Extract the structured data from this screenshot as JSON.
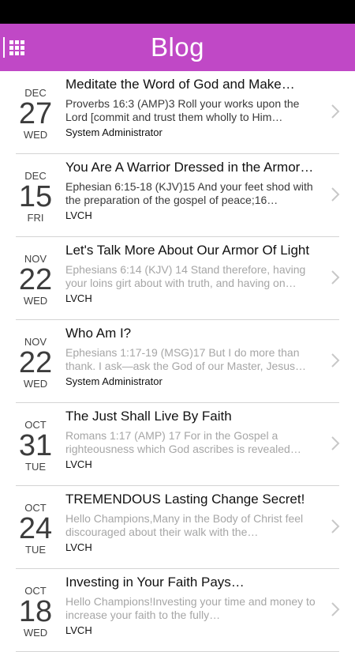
{
  "app": {
    "title": "Blog"
  },
  "icons": {
    "menu": "grid-menu-icon",
    "chevron": "chevron-right-icon"
  },
  "colors": {
    "appbar": "#c048c6",
    "statusbar": "#000000"
  },
  "posts": [
    {
      "month": "DEC",
      "day": "27",
      "dow": "WED",
      "title": "Meditate the Word of God and Make…",
      "excerpt": "Proverbs 16:3 (AMP)3 Roll your works upon the Lord [commit and trust them wholly to Him…",
      "author": "System Administrator",
      "faded": false
    },
    {
      "month": "DEC",
      "day": "15",
      "dow": "FRI",
      "title": "You Are A Warrior Dressed in the Armor…",
      "excerpt": "Ephesian 6:15-18 (KJV)15 And your feet shod with the preparation of the gospel of peace;16…",
      "author": "LVCH",
      "faded": false
    },
    {
      "month": "NOV",
      "day": "22",
      "dow": "WED",
      "title": "Let's Talk More About Our Armor Of Light",
      "excerpt": "Ephesians 6:14 (KJV) 14 Stand therefore, having your loins girt about with truth, and having on…",
      "author": "LVCH",
      "faded": true
    },
    {
      "month": "NOV",
      "day": "22",
      "dow": "WED",
      "title": "Who Am I?",
      "excerpt": "Ephesians 1:17-19 (MSG)17 But I do more than thank. I ask—ask the God of our Master, Jesus…",
      "author": "System Administrator",
      "faded": true
    },
    {
      "month": "OCT",
      "day": "31",
      "dow": "TUE",
      "title": " The Just Shall Live By Faith",
      "excerpt": "Romans 1:17 (AMP) 17 For in the Gospel a righteousness which God ascribes is revealed…",
      "author": "LVCH",
      "faded": true
    },
    {
      "month": "OCT",
      "day": "24",
      "dow": "TUE",
      "title": " TREMENDOUS Lasting Change Secret!",
      "excerpt": "Hello Champions,Many in the Body of Christ feel discouraged about their walk with the…",
      "author": "LVCH",
      "faded": true
    },
    {
      "month": "OCT",
      "day": "18",
      "dow": "WED",
      "title": "Investing in Your Faith Pays…",
      "excerpt": "Hello Champions!Investing your time and money to increase your faith to the fully…",
      "author": "LVCH",
      "faded": true
    }
  ]
}
